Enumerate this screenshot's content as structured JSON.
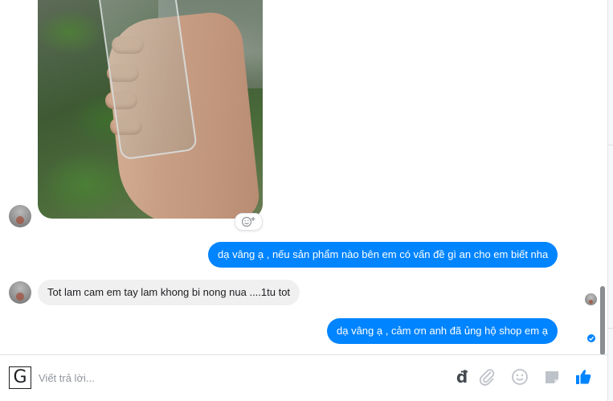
{
  "messages": [
    {
      "direction": "incoming",
      "type": "photo",
      "icon": "add-reaction-icon"
    },
    {
      "direction": "outgoing",
      "text": "dạ vâng ạ , nếu sản phẩm nào bên em có vấn đề gì an cho em biết nha"
    },
    {
      "direction": "incoming",
      "text": "Tot lam cam em tay lam khong bi nong nua ....1tu tot"
    },
    {
      "direction": "outgoing",
      "text": "dạ vâng ạ ,  cảm ơn   anh đã ủng hộ shop em ạ",
      "status_icon": "seen-check-icon"
    }
  ],
  "composer": {
    "placeholder": "Viết trả lời...",
    "grammar_icon_letter": "G",
    "currency_symbol": "đ",
    "tools": [
      "dong-currency-icon",
      "paperclip-icon",
      "emoji-icon",
      "sticker-icon",
      "thumbs-up-icon"
    ]
  },
  "colors": {
    "outgoing_bubble": "#0084ff",
    "incoming_bubble": "#f1f0f0",
    "like_button": "#0084ff",
    "tool_icons": "#bec2c9"
  }
}
